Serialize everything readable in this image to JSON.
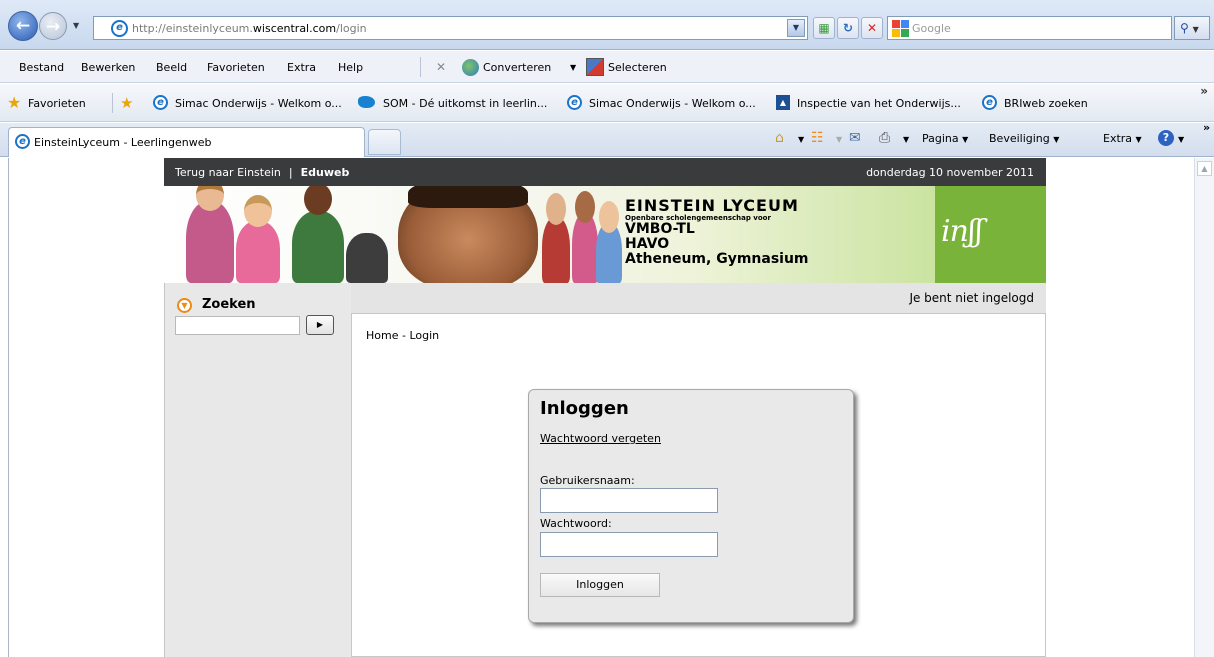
{
  "browser": {
    "address_url_prefix": "http://einsteinlyceum.",
    "address_url_domain": "wiscentral.com",
    "address_url_suffix": "/login",
    "search_placeholder": "Google"
  },
  "menubar": {
    "items": [
      "Bestand",
      "Bewerken",
      "Beeld",
      "Favorieten",
      "Extra",
      "Help"
    ],
    "converteren_label": "Converteren",
    "selecteren_label": "Selecteren"
  },
  "favorites": {
    "label": "Favorieten",
    "links": [
      "Simac Onderwijs - Welkom o...",
      "SOM - Dé uitkomst in leerlin...",
      "Simac Onderwijs - Welkom o...",
      "Inspectie van het Onderwijs...",
      "BRIweb zoeken"
    ]
  },
  "tabs": {
    "active_title": "EinsteinLyceum - Leerlingenweb",
    "commands": [
      "Pagina",
      "Beveiliging",
      "Extra"
    ]
  },
  "site": {
    "top_links": [
      "Terug naar Einstein",
      "Eduweb"
    ],
    "date": "donderdag 10 november 2011",
    "banner": {
      "title": "EINSTEIN LYCEUM",
      "subtitle": "Openbare scholengemeenschap voor",
      "lines": [
        "VMBO-TL",
        "HAVO",
        "Atheneum, Gymnasium"
      ]
    },
    "search_title": "Zoeken",
    "login_status": "Je bent niet ingelogd",
    "breadcrumb": "Home - Login",
    "login": {
      "title": "Inloggen",
      "forgot_link": "Wachtwoord vergeten",
      "username_label": "Gebruikersnaam:",
      "password_label": "Wachtwoord:",
      "submit_label": "Inloggen"
    }
  },
  "colors": {
    "site_topbar": "#3a3b3d",
    "logo_green": "#7ab33a",
    "sidebar_gray": "#e8e8e8"
  }
}
